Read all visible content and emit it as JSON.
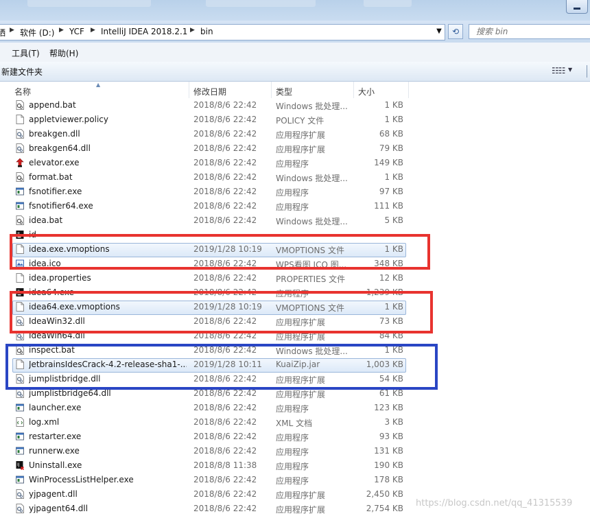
{
  "window": {
    "minimize_label": "minimize"
  },
  "address": {
    "crumbs": [
      "软件 (D:)",
      "YCF",
      "IntelliJ IDEA 2018.2.1",
      "bin"
    ],
    "partial_prefix": "哂"
  },
  "search": {
    "placeholder": "搜索 bin"
  },
  "menu": {
    "tools": "工具(T)",
    "help": "帮助(H)"
  },
  "toolbar": {
    "new_folder": "新建文件夹"
  },
  "columns": {
    "name": "名称",
    "date": "修改日期",
    "type": "类型",
    "size": "大小"
  },
  "files": [
    {
      "name": "append.bat",
      "date": "2018/8/6 22:42",
      "type": "Windows 批处理...",
      "size": "1 KB",
      "icon": "bat-icon"
    },
    {
      "name": "appletviewer.policy",
      "date": "2018/8/6 22:42",
      "type": "POLICY 文件",
      "size": "1 KB",
      "icon": "file-icon"
    },
    {
      "name": "breakgen.dll",
      "date": "2018/8/6 22:42",
      "type": "应用程序扩展",
      "size": "68 KB",
      "icon": "dll-icon"
    },
    {
      "name": "breakgen64.dll",
      "date": "2018/8/6 22:42",
      "type": "应用程序扩展",
      "size": "79 KB",
      "icon": "dll-icon"
    },
    {
      "name": "elevator.exe",
      "date": "2018/8/6 22:42",
      "type": "应用程序",
      "size": "149 KB",
      "icon": "elevator-icon"
    },
    {
      "name": "format.bat",
      "date": "2018/8/6 22:42",
      "type": "Windows 批处理...",
      "size": "1 KB",
      "icon": "bat-icon"
    },
    {
      "name": "fsnotifier.exe",
      "date": "2018/8/6 22:42",
      "type": "应用程序",
      "size": "97 KB",
      "icon": "exe-icon"
    },
    {
      "name": "fsnotifier64.exe",
      "date": "2018/8/6 22:42",
      "type": "应用程序",
      "size": "111 KB",
      "icon": "exe-icon"
    },
    {
      "name": "idea.bat",
      "date": "2018/8/6 22:42",
      "type": "Windows 批处理...",
      "size": "5 KB",
      "icon": "bat-icon"
    },
    {
      "name": "id",
      "date": "",
      "type": "",
      "size": "",
      "icon": "idea-icon"
    },
    {
      "name": "idea.exe.vmoptions",
      "date": "2019/1/28 10:19",
      "type": "VMOPTIONS 文件",
      "size": "1 KB",
      "icon": "file-icon",
      "selected": true
    },
    {
      "name": "idea.ico",
      "date": "2018/8/6 22:42",
      "type": "WPS看图 ICO 图...",
      "size": "348 KB",
      "icon": "ico-icon"
    },
    {
      "name": "idea.properties",
      "date": "2018/8/6 22:42",
      "type": "PROPERTIES 文件",
      "size": "12 KB",
      "icon": "file-icon"
    },
    {
      "name": "idea64.exe",
      "date": "2018/8/6 22:42",
      "type": "应用程序",
      "size": "1,239 KB",
      "icon": "idea-icon"
    },
    {
      "name": "idea64.exe.vmoptions",
      "date": "2019/1/28 10:19",
      "type": "VMOPTIONS 文件",
      "size": "1 KB",
      "icon": "file-icon",
      "selected": true
    },
    {
      "name": "IdeaWin32.dll",
      "date": "2018/8/6 22:42",
      "type": "应用程序扩展",
      "size": "73 KB",
      "icon": "dll-icon"
    },
    {
      "name": "IdeaWin64.dll",
      "date": "2018/8/6 22:42",
      "type": "应用程序扩展",
      "size": "84 KB",
      "icon": "dll-icon"
    },
    {
      "name": "inspect.bat",
      "date": "2018/8/6 22:42",
      "type": "Windows 批处理...",
      "size": "1 KB",
      "icon": "bat-icon"
    },
    {
      "name": "JetbrainsIdesCrack-4.2-release-sha1-...",
      "date": "2019/1/28 10:11",
      "type": "KuaiZip.jar",
      "size": "1,003 KB",
      "icon": "file-icon",
      "selected": true
    },
    {
      "name": "jumplistbridge.dll",
      "date": "2018/8/6 22:42",
      "type": "应用程序扩展",
      "size": "54 KB",
      "icon": "dll-icon"
    },
    {
      "name": "jumplistbridge64.dll",
      "date": "2018/8/6 22:42",
      "type": "应用程序扩展",
      "size": "61 KB",
      "icon": "dll-icon"
    },
    {
      "name": "launcher.exe",
      "date": "2018/8/6 22:42",
      "type": "应用程序",
      "size": "123 KB",
      "icon": "exe-icon"
    },
    {
      "name": "log.xml",
      "date": "2018/8/6 22:42",
      "type": "XML 文档",
      "size": "3 KB",
      "icon": "xml-icon"
    },
    {
      "name": "restarter.exe",
      "date": "2018/8/6 22:42",
      "type": "应用程序",
      "size": "93 KB",
      "icon": "exe-icon"
    },
    {
      "name": "runnerw.exe",
      "date": "2018/8/6 22:42",
      "type": "应用程序",
      "size": "131 KB",
      "icon": "exe-icon"
    },
    {
      "name": "Uninstall.exe",
      "date": "2018/8/8 11:38",
      "type": "应用程序",
      "size": "190 KB",
      "icon": "uninstall-icon"
    },
    {
      "name": "WinProcessListHelper.exe",
      "date": "2018/8/6 22:42",
      "type": "应用程序",
      "size": "178 KB",
      "icon": "exe-icon"
    },
    {
      "name": "yjpagent.dll",
      "date": "2018/8/6 22:42",
      "type": "应用程序扩展",
      "size": "2,450 KB",
      "icon": "dll-icon"
    },
    {
      "name": "yjpagent64.dll",
      "date": "2018/8/6 22:42",
      "type": "应用程序扩展",
      "size": "2,754 KB",
      "icon": "dll-icon"
    }
  ],
  "annotations": {
    "red": "#e8332f",
    "blue": "#2a46c4"
  },
  "watermark": "https://blog.csdn.net/qq_41315539"
}
